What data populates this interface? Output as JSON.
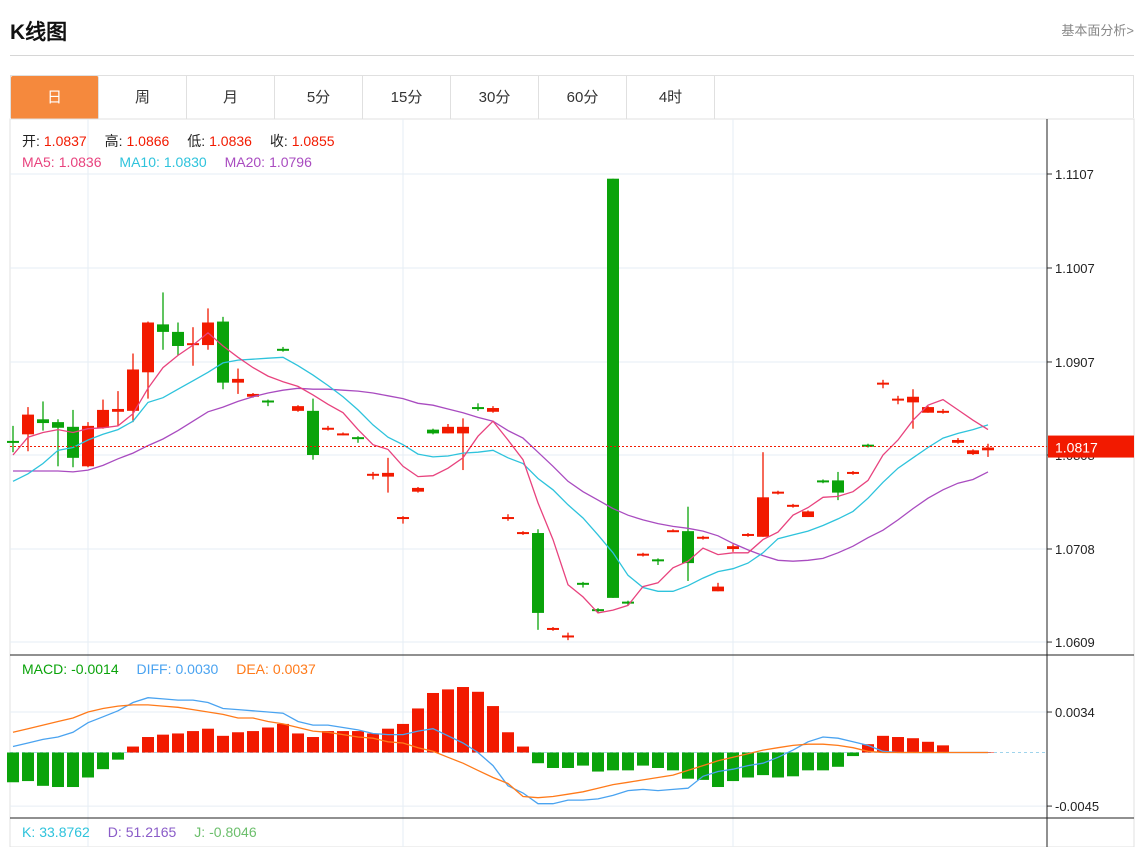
{
  "header": {
    "title": "K线图",
    "more_link": "基本面分析>"
  },
  "tabs": [
    {
      "label": "日",
      "active": true
    },
    {
      "label": "周"
    },
    {
      "label": "月"
    },
    {
      "label": "5分"
    },
    {
      "label": "15分"
    },
    {
      "label": "30分"
    },
    {
      "label": "60分"
    },
    {
      "label": "4时"
    }
  ],
  "info": {
    "open_label": "开:",
    "open": "1.0837",
    "high_label": "高:",
    "high": "1.0866",
    "low_label": "低:",
    "low": "1.0836",
    "close_label": "收:",
    "close": "1.0855",
    "ma5_label": "MA5:",
    "ma5": "1.0836",
    "ma10_label": "MA10:",
    "ma10": "1.0830",
    "ma20_label": "MA20:",
    "ma20": "1.0796"
  },
  "macd_info": {
    "macd_label": "MACD:",
    "macd": "-0.0014",
    "diff_label": "DIFF:",
    "diff": "0.0030",
    "dea_label": "DEA:",
    "dea": "0.0037"
  },
  "kdj_info": {
    "k_label": "K:",
    "k": "33.8762",
    "d_label": "D:",
    "d": "51.2165",
    "j_label": "J:",
    "j": "-0.8046"
  },
  "colors": {
    "up": "#F21A00",
    "down": "#0AA30A",
    "ma5": "#E8437E",
    "ma10": "#2EC3DC",
    "ma20": "#A94CC0",
    "diff": "#4AA3F0",
    "dea": "#FF7A1A",
    "accent": "#F5893D",
    "last": "#F21A00"
  },
  "chart_data": {
    "type": "candlestick",
    "price_ticks": [
      "1.1107",
      "1.1007",
      "1.0907",
      "1.0808",
      "1.0708",
      "1.0609"
    ],
    "ylim": [
      1.0609,
      1.1107
    ],
    "last_price": "1.0817",
    "macd_ticks": [
      "0.0034",
      "-0.0045"
    ],
    "ohlc": [
      [
        1.0823,
        1.0839,
        1.0811,
        1.0821
      ],
      [
        1.083,
        1.0859,
        1.0812,
        1.0851
      ],
      [
        1.0846,
        1.0865,
        1.0834,
        1.0842
      ],
      [
        1.0843,
        1.0846,
        1.0796,
        1.0837
      ],
      [
        1.0838,
        1.0856,
        1.0795,
        1.0805
      ],
      [
        1.0796,
        1.0843,
        1.0795,
        1.0839
      ],
      [
        1.0837,
        1.0867,
        1.0836,
        1.0856
      ],
      [
        1.0854,
        1.0876,
        1.0839,
        1.0857
      ],
      [
        1.0855,
        1.0916,
        1.0843,
        1.0899
      ],
      [
        1.0896,
        1.095,
        1.0868,
        1.0949
      ],
      [
        1.0947,
        1.0981,
        1.092,
        1.0939
      ],
      [
        1.0939,
        1.0949,
        1.0914,
        1.0924
      ],
      [
        1.0925,
        1.0944,
        1.0903,
        1.0927
      ],
      [
        1.0925,
        1.0964,
        1.092,
        1.0949
      ],
      [
        1.095,
        1.0955,
        1.0878,
        1.0885
      ],
      [
        1.0885,
        1.09,
        1.0873,
        1.0889
      ],
      [
        1.087,
        1.0874,
        1.0869,
        1.0873
      ],
      [
        1.0866,
        1.0867,
        1.086,
        1.0864
      ],
      [
        1.0921,
        1.0923,
        1.0918,
        1.092
      ],
      [
        1.0855,
        1.0861,
        1.0854,
        1.086
      ],
      [
        1.0855,
        1.0868,
        1.0803,
        1.0808
      ],
      [
        1.0836,
        1.0839,
        1.0834,
        1.0837
      ],
      [
        1.083,
        1.0832,
        1.0829,
        1.0831
      ],
      [
        1.0827,
        1.0828,
        1.0821,
        1.0825
      ],
      [
        1.0786,
        1.079,
        1.0782,
        1.0788
      ],
      [
        1.0785,
        1.0805,
        1.0768,
        1.0789
      ],
      [
        1.0741,
        1.0743,
        1.0735,
        1.0742
      ],
      [
        1.0769,
        1.0774,
        1.0768,
        1.0773
      ],
      [
        1.0835,
        1.0836,
        1.083,
        1.0831
      ],
      [
        1.0831,
        1.0841,
        1.0831,
        1.0838
      ],
      [
        1.0831,
        1.0847,
        1.0792,
        1.0838
      ],
      [
        1.0859,
        1.0863,
        1.0855,
        1.0858
      ],
      [
        1.0854,
        1.086,
        1.0853,
        1.0858
      ],
      [
        1.074,
        1.0745,
        1.0738,
        1.0742
      ],
      [
        1.0724,
        1.0727,
        1.0723,
        1.0726
      ],
      [
        1.0725,
        1.0729,
        1.0622,
        1.064
      ],
      [
        1.0622,
        1.0625,
        1.0621,
        1.0624
      ],
      [
        1.0614,
        1.0619,
        1.0611,
        1.0616
      ],
      [
        1.0672,
        1.0673,
        1.0667,
        1.067
      ],
      [
        1.0644,
        1.0645,
        1.064,
        1.0642
      ],
      [
        1.1102,
        1.1102,
        1.0656,
        1.0656
      ],
      [
        1.0652,
        1.0653,
        1.0648,
        1.065
      ],
      [
        1.0701,
        1.0704,
        1.07,
        1.0703
      ],
      [
        1.0697,
        1.0698,
        1.0691,
        1.0695
      ],
      [
        1.0726,
        1.0729,
        1.0726,
        1.0728
      ],
      [
        1.0727,
        1.0753,
        1.0674,
        1.0693
      ],
      [
        1.0719,
        1.0722,
        1.0718,
        1.0721
      ],
      [
        1.0663,
        1.0672,
        1.0663,
        1.0668
      ],
      [
        1.0708,
        1.0713,
        1.0705,
        1.0711
      ],
      [
        1.0722,
        1.0725,
        1.0721,
        1.0724
      ],
      [
        1.0721,
        1.0811,
        1.0721,
        1.0763
      ],
      [
        1.0767,
        1.077,
        1.0766,
        1.0769
      ],
      [
        1.0753,
        1.0756,
        1.0752,
        1.0755
      ],
      [
        1.0742,
        1.0749,
        1.0742,
        1.0748
      ],
      [
        1.0781,
        1.0782,
        1.0778,
        1.0779
      ],
      [
        1.0781,
        1.079,
        1.076,
        1.0768
      ],
      [
        1.0788,
        1.0791,
        1.0787,
        1.079
      ],
      [
        1.0819,
        1.082,
        1.0816,
        1.0817
      ],
      [
        1.0883,
        1.0888,
        1.0879,
        1.0885
      ],
      [
        1.0866,
        1.0871,
        1.0862,
        1.0868
      ],
      [
        1.0864,
        1.0878,
        1.0836,
        1.087
      ],
      [
        1.0853,
        1.086,
        1.0853,
        1.0859
      ],
      [
        1.0853,
        1.0857,
        1.0852,
        1.0855
      ],
      [
        1.0821,
        1.0826,
        1.082,
        1.0824
      ],
      [
        1.0809,
        1.0814,
        1.0808,
        1.0813
      ],
      [
        1.0813,
        1.082,
        1.0806,
        1.0816
      ]
    ],
    "ma5": [
      1.0808,
      1.0827,
      1.0832,
      1.0835,
      1.0832,
      1.0836,
      1.0837,
      1.0839,
      1.0852,
      1.0879,
      1.0901,
      1.0914,
      1.0925,
      1.0938,
      1.0924,
      1.0912,
      1.0901,
      1.0892,
      1.0886,
      1.0881,
      1.0872,
      1.0862,
      1.0853,
      1.0835,
      1.0819,
      1.0814,
      1.0796,
      1.0785,
      1.0786,
      1.0794,
      1.0805,
      1.0828,
      1.0844,
      1.0824,
      1.0803,
      1.0757,
      1.0718,
      1.067,
      1.0657,
      1.064,
      1.0643,
      1.0648,
      1.0668,
      1.0672,
      1.0688,
      1.0695,
      1.0709,
      1.0702,
      1.0704,
      1.0704,
      1.0718,
      1.0726,
      1.0744,
      1.0752,
      1.0763,
      1.0764,
      1.0769,
      1.0781,
      1.0808,
      1.0824,
      1.0845,
      1.0861,
      1.0867,
      1.0856,
      1.0845,
      1.0835
    ],
    "ma10": [
      1.078,
      1.0788,
      1.0799,
      1.0813,
      1.0816,
      1.0824,
      1.083,
      1.0835,
      1.0844,
      1.0864,
      1.0869,
      1.0878,
      1.0887,
      1.0896,
      1.0906,
      1.0909,
      1.091,
      1.0911,
      1.0912,
      1.0903,
      1.0893,
      1.0882,
      1.087,
      1.0856,
      1.084,
      1.0827,
      1.0819,
      1.0809,
      1.0806,
      1.0807,
      1.081,
      1.0811,
      1.0813,
      1.0805,
      1.0799,
      1.0783,
      1.0771,
      1.0755,
      1.0741,
      1.0723,
      1.0704,
      1.068,
      1.0667,
      1.0663,
      1.0663,
      1.0669,
      1.0677,
      1.0684,
      1.0687,
      1.0693,
      1.0704,
      1.0719,
      1.0723,
      1.0727,
      1.0733,
      1.074,
      1.0748,
      1.0762,
      1.0779,
      1.0794,
      1.0805,
      1.0816,
      1.0826,
      1.0831,
      1.0835,
      1.084
    ],
    "ma20": [
      1.0791,
      1.0791,
      1.0791,
      1.0791,
      1.079,
      1.0792,
      1.0797,
      1.0804,
      1.081,
      1.0818,
      1.0825,
      1.0834,
      1.0844,
      1.0854,
      1.0859,
      1.0865,
      1.087,
      1.0874,
      1.0877,
      1.0879,
      1.0878,
      1.0878,
      1.0877,
      1.0876,
      1.0874,
      1.0871,
      1.0868,
      1.0863,
      1.0861,
      1.0857,
      1.0853,
      1.0848,
      1.0844,
      1.0834,
      1.0826,
      1.0811,
      1.0796,
      1.078,
      1.0769,
      1.076,
      1.0751,
      1.0744,
      1.0739,
      1.0735,
      1.0732,
      1.073,
      1.0727,
      1.0722,
      1.0714,
      1.0707,
      1.0701,
      1.0696,
      1.0695,
      1.0696,
      1.0698,
      1.0704,
      1.0711,
      1.072,
      1.0728,
      1.0739,
      1.0751,
      1.0762,
      1.0771,
      1.0778,
      1.0782,
      1.079
    ],
    "macd_hist": [
      -0.0025,
      -0.0024,
      -0.0028,
      -0.0029,
      -0.0029,
      -0.0021,
      -0.0014,
      -0.0006,
      0.0005,
      0.0013,
      0.0015,
      0.0016,
      0.0018,
      0.002,
      0.0014,
      0.0017,
      0.0018,
      0.0021,
      0.0024,
      0.0016,
      0.0013,
      0.0018,
      0.0018,
      0.0018,
      0.0016,
      0.002,
      0.0024,
      0.0037,
      0.005,
      0.0053,
      0.0055,
      0.0051,
      0.0039,
      0.0017,
      0.0005,
      -0.0009,
      -0.0013,
      -0.0013,
      -0.0011,
      -0.0016,
      -0.0015,
      -0.0015,
      -0.0011,
      -0.0013,
      -0.0015,
      -0.0022,
      -0.0023,
      -0.0029,
      -0.0024,
      -0.0021,
      -0.0019,
      -0.0021,
      -0.002,
      -0.0015,
      -0.0015,
      -0.0012,
      -0.0003,
      0.0007,
      0.0014,
      0.0013,
      0.0012,
      0.0009,
      0.0006,
      0,
      0,
      0
    ],
    "diff": [
      0.0005,
      0.0008,
      0.0011,
      0.0013,
      0.0017,
      0.0025,
      0.003,
      0.0035,
      0.0042,
      0.0046,
      0.0045,
      0.0044,
      0.0044,
      0.0042,
      0.0037,
      0.0036,
      0.0035,
      0.0034,
      0.0033,
      0.0026,
      0.0023,
      0.0023,
      0.0021,
      0.0019,
      0.0016,
      0.0015,
      0.0015,
      0.0018,
      0.002,
      0.0014,
      0.0008,
      0,
      -0.0011,
      -0.0028,
      -0.0034,
      -0.0043,
      -0.0043,
      -0.004,
      -0.004,
      -0.0039,
      -0.0036,
      -0.0032,
      -0.0031,
      -0.0032,
      -0.0031,
      -0.003,
      -0.002,
      -0.0016,
      -0.0014,
      -0.0011,
      -0.0009,
      -0.0004,
      0.0002,
      0.0009,
      0.0013,
      0.0012,
      0.0009,
      0.0006,
      0.0001,
      0,
      0,
      0,
      0,
      0,
      0,
      0
    ],
    "dea": [
      0.0017,
      0.002,
      0.0023,
      0.0026,
      0.0029,
      0.0034,
      0.0037,
      0.0039,
      0.004,
      0.004,
      0.0039,
      0.0038,
      0.0036,
      0.0034,
      0.0032,
      0.0029,
      0.0029,
      0.0026,
      0.0024,
      0.0021,
      0.0018,
      0.0017,
      0.0015,
      0.0013,
      0.0012,
      0.0009,
      0.0008,
      0.0004,
      0.0001,
      -0.0004,
      -0.0009,
      -0.0015,
      -0.0021,
      -0.0026,
      -0.0037,
      -0.0038,
      -0.0037,
      -0.0035,
      -0.0033,
      -0.003,
      -0.0027,
      -0.0025,
      -0.0023,
      -0.0021,
      -0.0019,
      -0.0015,
      -0.0011,
      -0.0007,
      -0.0004,
      -0.0001,
      0.0002,
      0.0004,
      0.0006,
      0.0007,
      0.0007,
      0.0006,
      0.0004,
      0.0001,
      0,
      0,
      0,
      0,
      0,
      0,
      0,
      0
    ]
  }
}
